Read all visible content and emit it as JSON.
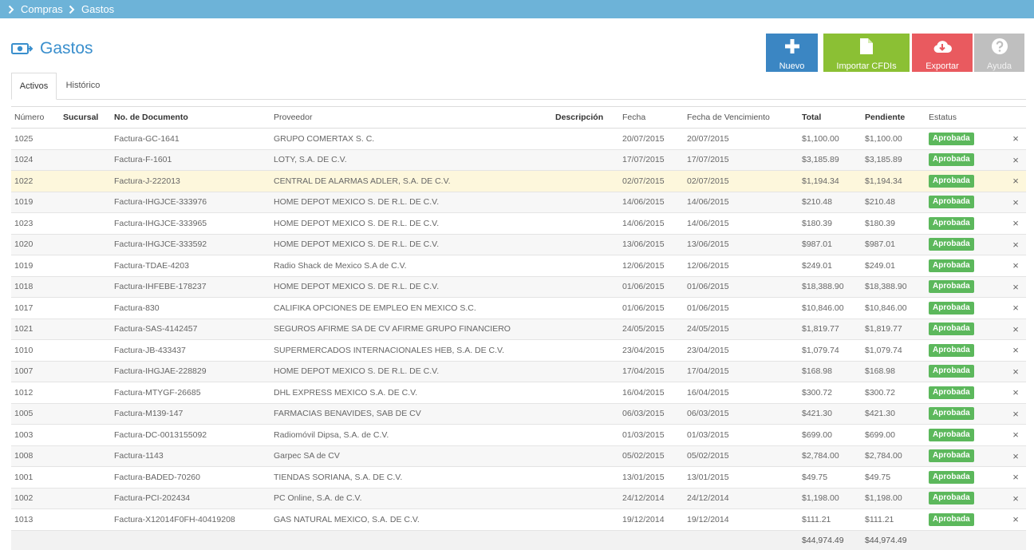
{
  "breadcrumb": {
    "items": [
      "Compras",
      "Gastos"
    ]
  },
  "page": {
    "title": "Gastos",
    "icon": "money-bill-arrow-icon"
  },
  "toolbar": {
    "nuevo": "Nuevo",
    "importar": "Importar CFDIs",
    "exportar": "Exportar",
    "ayuda": "Ayuda"
  },
  "tabs": [
    "Activos",
    "Histórico"
  ],
  "table": {
    "headers": {
      "numero": "Número",
      "sucursal": "Sucursal",
      "documento": "No. de Documento",
      "proveedor": "Proveedor",
      "descripcion": "Descripción",
      "fecha": "Fecha",
      "vencimiento": "Fecha de Vencimiento",
      "total": "Total",
      "pendiente": "Pendiente",
      "estatus": "Estatus"
    },
    "rows": [
      {
        "numero": "1025",
        "sucursal": "",
        "documento": "Factura-GC-1641",
        "proveedor": "GRUPO COMERTAX S. C.",
        "descripcion": "",
        "fecha": "20/07/2015",
        "vencimiento": "20/07/2015",
        "total": "$1,100.00",
        "pendiente": "$1,100.00",
        "estatus": "Aprobada"
      },
      {
        "numero": "1024",
        "sucursal": "",
        "documento": "Factura-F-1601",
        "proveedor": "LOTY, S.A. DE C.V.",
        "descripcion": "",
        "fecha": "17/07/2015",
        "vencimiento": "17/07/2015",
        "total": "$3,185.89",
        "pendiente": "$3,185.89",
        "estatus": "Aprobada"
      },
      {
        "numero": "1022",
        "sucursal": "",
        "documento": "Factura-J-222013",
        "proveedor": "CENTRAL DE ALARMAS ADLER, S.A. DE C.V.",
        "descripcion": "",
        "fecha": "02/07/2015",
        "vencimiento": "02/07/2015",
        "total": "$1,194.34",
        "pendiente": "$1,194.34",
        "estatus": "Aprobada"
      },
      {
        "numero": "1019",
        "sucursal": "",
        "documento": "Factura-IHGJCE-333976",
        "proveedor": "HOME DEPOT MEXICO S. DE R.L. DE C.V.",
        "descripcion": "",
        "fecha": "14/06/2015",
        "vencimiento": "14/06/2015",
        "total": "$210.48",
        "pendiente": "$210.48",
        "estatus": "Aprobada"
      },
      {
        "numero": "1023",
        "sucursal": "",
        "documento": "Factura-IHGJCE-333965",
        "proveedor": "HOME DEPOT MEXICO S. DE R.L. DE C.V.",
        "descripcion": "",
        "fecha": "14/06/2015",
        "vencimiento": "14/06/2015",
        "total": "$180.39",
        "pendiente": "$180.39",
        "estatus": "Aprobada"
      },
      {
        "numero": "1020",
        "sucursal": "",
        "documento": "Factura-IHGJCE-333592",
        "proveedor": "HOME DEPOT MEXICO S. DE R.L. DE C.V.",
        "descripcion": "",
        "fecha": "13/06/2015",
        "vencimiento": "13/06/2015",
        "total": "$987.01",
        "pendiente": "$987.01",
        "estatus": "Aprobada"
      },
      {
        "numero": "1019",
        "sucursal": "",
        "documento": "Factura-TDAE-4203",
        "proveedor": "Radio Shack de Mexico S.A de C.V.",
        "descripcion": "",
        "fecha": "12/06/2015",
        "vencimiento": "12/06/2015",
        "total": "$249.01",
        "pendiente": "$249.01",
        "estatus": "Aprobada"
      },
      {
        "numero": "1018",
        "sucursal": "",
        "documento": "Factura-IHFEBE-178237",
        "proveedor": "HOME DEPOT MEXICO S. DE R.L. DE C.V.",
        "descripcion": "",
        "fecha": "01/06/2015",
        "vencimiento": "01/06/2015",
        "total": "$18,388.90",
        "pendiente": "$18,388.90",
        "estatus": "Aprobada"
      },
      {
        "numero": "1017",
        "sucursal": "",
        "documento": "Factura-830",
        "proveedor": "CALIFIKA OPCIONES DE EMPLEO EN MEXICO S.C.",
        "descripcion": "",
        "fecha": "01/06/2015",
        "vencimiento": "01/06/2015",
        "total": "$10,846.00",
        "pendiente": "$10,846.00",
        "estatus": "Aprobada"
      },
      {
        "numero": "1021",
        "sucursal": "",
        "documento": "Factura-SAS-4142457",
        "proveedor": "SEGUROS AFIRME SA DE CV AFIRME GRUPO FINANCIERO",
        "descripcion": "",
        "fecha": "24/05/2015",
        "vencimiento": "24/05/2015",
        "total": "$1,819.77",
        "pendiente": "$1,819.77",
        "estatus": "Aprobada"
      },
      {
        "numero": "1010",
        "sucursal": "",
        "documento": "Factura-JB-433437",
        "proveedor": "SUPERMERCADOS INTERNACIONALES HEB, S.A. DE C.V.",
        "descripcion": "",
        "fecha": "23/04/2015",
        "vencimiento": "23/04/2015",
        "total": "$1,079.74",
        "pendiente": "$1,079.74",
        "estatus": "Aprobada"
      },
      {
        "numero": "1007",
        "sucursal": "",
        "documento": "Factura-IHGJAE-228829",
        "proveedor": "HOME DEPOT MEXICO S. DE R.L. DE C.V.",
        "descripcion": "",
        "fecha": "17/04/2015",
        "vencimiento": "17/04/2015",
        "total": "$168.98",
        "pendiente": "$168.98",
        "estatus": "Aprobada"
      },
      {
        "numero": "1012",
        "sucursal": "",
        "documento": "Factura-MTYGF-26685",
        "proveedor": "DHL EXPRESS MEXICO S.A. DE C.V.",
        "descripcion": "",
        "fecha": "16/04/2015",
        "vencimiento": "16/04/2015",
        "total": "$300.72",
        "pendiente": "$300.72",
        "estatus": "Aprobada"
      },
      {
        "numero": "1005",
        "sucursal": "",
        "documento": "Factura-M139-147",
        "proveedor": "FARMACIAS BENAVIDES, SAB DE CV",
        "descripcion": "",
        "fecha": "06/03/2015",
        "vencimiento": "06/03/2015",
        "total": "$421.30",
        "pendiente": "$421.30",
        "estatus": "Aprobada"
      },
      {
        "numero": "1003",
        "sucursal": "",
        "documento": "Factura-DC-0013155092",
        "proveedor": "Radiomóvil Dipsa, S.A. de C.V.",
        "descripcion": "",
        "fecha": "01/03/2015",
        "vencimiento": "01/03/2015",
        "total": "$699.00",
        "pendiente": "$699.00",
        "estatus": "Aprobada"
      },
      {
        "numero": "1008",
        "sucursal": "",
        "documento": "Factura-1143",
        "proveedor": "Garpec SA de CV",
        "descripcion": "",
        "fecha": "05/02/2015",
        "vencimiento": "05/02/2015",
        "total": "$2,784.00",
        "pendiente": "$2,784.00",
        "estatus": "Aprobada"
      },
      {
        "numero": "1001",
        "sucursal": "",
        "documento": "Factura-BADED-70260",
        "proveedor": "TIENDAS SORIANA, S.A. DE C.V.",
        "descripcion": "",
        "fecha": "13/01/2015",
        "vencimiento": "13/01/2015",
        "total": "$49.75",
        "pendiente": "$49.75",
        "estatus": "Aprobada"
      },
      {
        "numero": "1002",
        "sucursal": "",
        "documento": "Factura-PCI-202434",
        "proveedor": "PC Online, S.A. de C.V.",
        "descripcion": "",
        "fecha": "24/12/2014",
        "vencimiento": "24/12/2014",
        "total": "$1,198.00",
        "pendiente": "$1,198.00",
        "estatus": "Aprobada"
      },
      {
        "numero": "1013",
        "sucursal": "",
        "documento": "Factura-X12014F0FH-40419208",
        "proveedor": "GAS NATURAL MEXICO, S.A. DE C.V.",
        "descripcion": "",
        "fecha": "19/12/2014",
        "vencimiento": "19/12/2014",
        "total": "$111.21",
        "pendiente": "$111.21",
        "estatus": "Aprobada"
      }
    ],
    "totals": {
      "total": "$44,974.49",
      "pendiente": "$44,974.49"
    },
    "highlight_row": 2,
    "delete_icon": "×"
  },
  "colors": {
    "topbar": "#6db3d8",
    "title": "#3a8fcd",
    "nuevo": "#3b86c3",
    "importar": "#8bc034",
    "exportar": "#e95a5f",
    "ayuda": "#bfbfbf",
    "badge": "#5cb85c",
    "highlight": "#fdf7dc"
  }
}
